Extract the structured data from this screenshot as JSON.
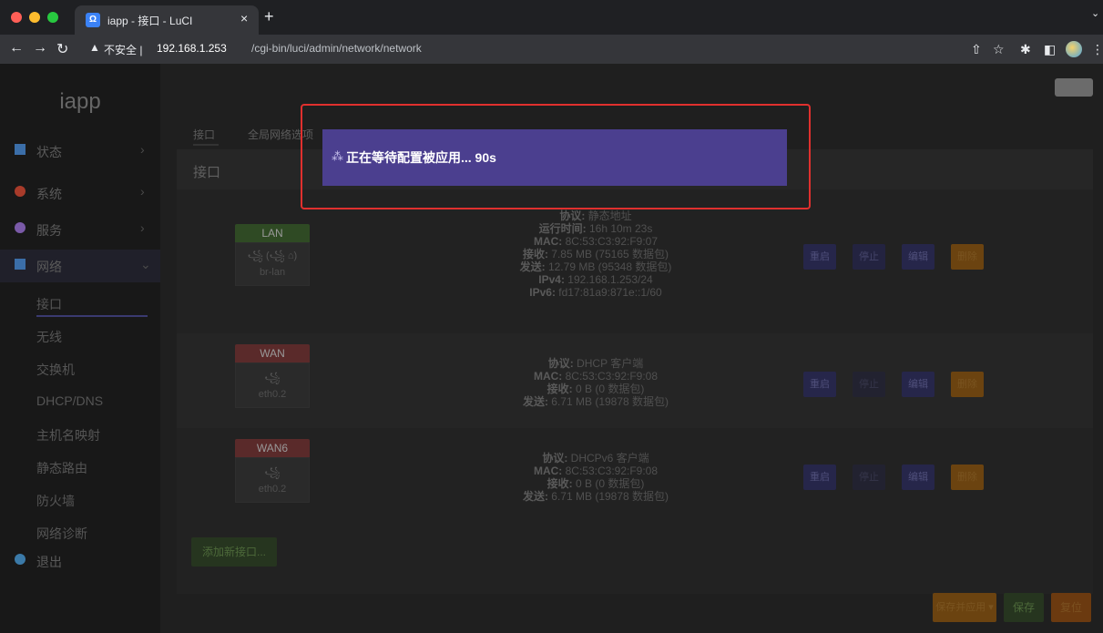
{
  "browser": {
    "tab_title": "iapp - 接口 - LuCI",
    "tab_icon": "Ω",
    "tab_close": "×",
    "new_tab": "+",
    "tab_menu": "⌄",
    "address_warning": "▲",
    "address_insecure": "不安全 |",
    "address_host": "192.168.1.253",
    "address_path": "/cgi-bin/luci/admin/network/network"
  },
  "sidebar": {
    "brand": "iapp",
    "items": [
      {
        "label": "状态",
        "icon": "status-icon",
        "color": "#3b6ea8"
      },
      {
        "label": "系统",
        "icon": "gear-icon",
        "color": "#a83b2a"
      },
      {
        "label": "服务",
        "icon": "service-icon",
        "color": "#7a5aa8"
      },
      {
        "label": "网络",
        "icon": "network-icon",
        "color": "#3b6ea8"
      },
      {
        "label": "退出",
        "icon": "logout-icon",
        "color": "#3b7aa8"
      }
    ],
    "network_sub": [
      "接口",
      "无线",
      "交换机",
      "DHCP/DNS",
      "主机名映射",
      "静态路由",
      "防火墙",
      "网络诊断"
    ]
  },
  "main": {
    "tabs": [
      "接口",
      "全局网络选项"
    ],
    "panel_title": "接口",
    "interfaces": [
      {
        "name": "LAN",
        "badge_color": "#2f4a24",
        "glyph": "꧁ (꧁ ⌂)",
        "device": "br-lan",
        "info": [
          [
            "协议:",
            " 静态地址"
          ],
          [
            "运行时间:",
            " 16h 10m 23s"
          ],
          [
            "MAC:",
            " 8C:53:C3:92:F9:07"
          ],
          [
            "接收:",
            " 7.85 MB (75165 数据包)"
          ],
          [
            "发送:",
            " 12.79 MB (95348 数据包)"
          ],
          [
            "IPv4:",
            " 192.168.1.253/24"
          ],
          [
            "IPv6:",
            " fd17:81a9:871e::1/60"
          ]
        ]
      },
      {
        "name": "WAN",
        "badge_color": "#5a2a2a",
        "glyph": "꧁",
        "device": "eth0.2",
        "info": [
          [
            "协议:",
            " DHCP 客户端"
          ],
          [
            "MAC:",
            " 8C:53:C3:92:F9:08"
          ],
          [
            "接收:",
            " 0 B (0 数据包)"
          ],
          [
            "发送:",
            " 6.71 MB (19878 数据包)"
          ]
        ]
      },
      {
        "name": "WAN6",
        "badge_color": "#5a2a2a",
        "glyph": "꧁",
        "device": "eth0.2",
        "info": [
          [
            "协议:",
            " DHCPv6 客户端"
          ],
          [
            "MAC:",
            " 8C:53:C3:92:F9:08"
          ],
          [
            "接收:",
            " 0 B (0 数据包)"
          ],
          [
            "发送:",
            " 6.71 MB (19878 数据包)"
          ]
        ]
      }
    ],
    "actions": {
      "restart": "重启",
      "stop": "停止",
      "edit": "编辑",
      "delete": "删除"
    },
    "add_interface": "添加新接口...",
    "footer": {
      "apply": "保存并应用 ▾",
      "save": "保存",
      "reset": "复位"
    }
  },
  "modal": {
    "spinner": "⁂",
    "text": "正在等待配置被应用... 90s"
  }
}
